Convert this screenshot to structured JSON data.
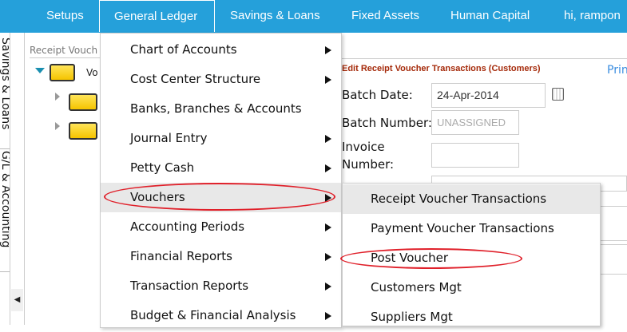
{
  "nav": {
    "items": [
      "Setups",
      "General Ledger",
      "Savings & Loans",
      "Fixed Assets",
      "Human Capital"
    ],
    "user": "hi, rampon"
  },
  "side_tabs": [
    "Savings & Loans",
    "G/L & Accounting"
  ],
  "tree": {
    "title": "Receipt Vouch",
    "root": "Vo"
  },
  "form": {
    "title": "Edit Receipt Voucher Transactions (Customers)",
    "print": "Prin",
    "batch_date_label": "Batch Date:",
    "batch_date": "24-Apr-2014",
    "batch_number_label": "Batch Number:",
    "batch_number_placeholder": "UNASSIGNED",
    "invoice_label_1": "Invoice",
    "invoice_label_2": "Number:"
  },
  "menu": [
    "Chart of Accounts",
    "Cost Center Structure",
    "Banks, Branches & Accounts",
    "Journal Entry",
    "Petty Cash",
    "Vouchers",
    "Accounting Periods",
    "Financial Reports",
    "Transaction Reports",
    "Budget & Financial Analysis"
  ],
  "submenu": [
    "Receipt Voucher Transactions",
    "Payment Voucher Transactions",
    "Post Voucher",
    "Customers Mgt",
    "Suppliers Mgt"
  ],
  "colors": {
    "nav": "#25a0da",
    "annotation": "#e0202a"
  }
}
